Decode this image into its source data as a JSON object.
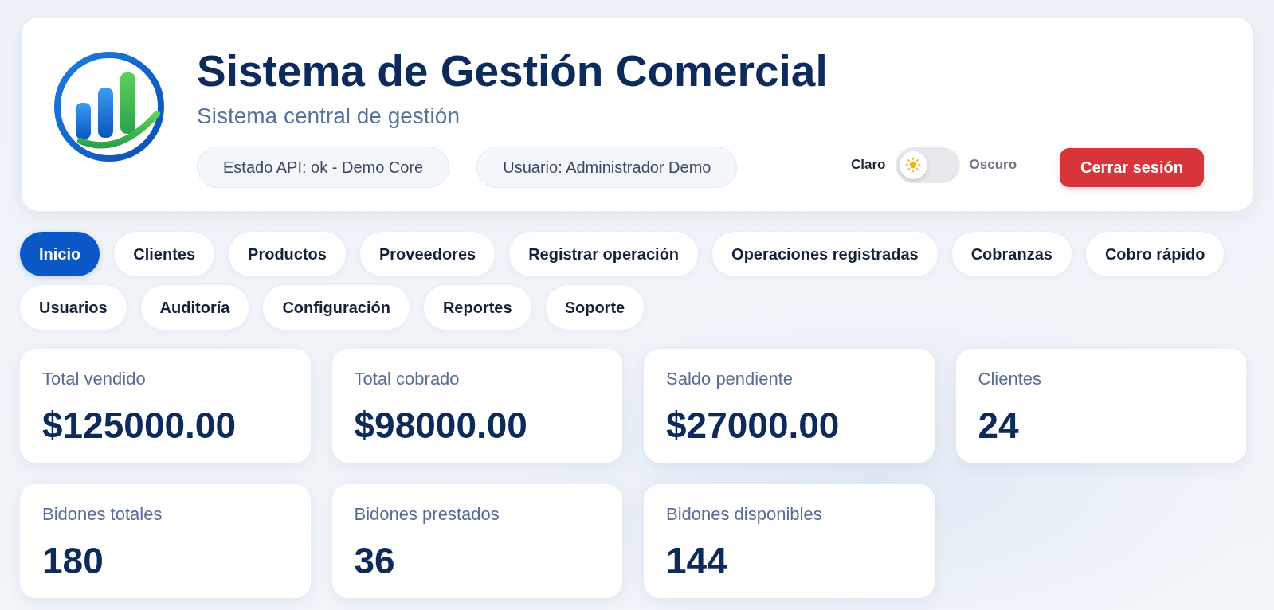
{
  "header": {
    "title": "Sistema de Gestión Comercial",
    "subtitle": "Sistema central de gestión",
    "status_pills": [
      "Estado API: ok - Demo Core",
      "Usuario: Administrador Demo"
    ],
    "theme_toggle": {
      "light_label": "Claro",
      "dark_label": "Oscuro",
      "dark": false
    },
    "logout_button": "Cerrar sesión"
  },
  "nav_tabs": [
    {
      "label": "Inicio",
      "selected": true
    },
    {
      "label": "Clientes",
      "selected": false
    },
    {
      "label": "Productos",
      "selected": false
    },
    {
      "label": "Proveedores",
      "selected": false
    },
    {
      "label": "Registrar operación",
      "selected": false
    },
    {
      "label": "Operaciones registradas",
      "selected": false
    },
    {
      "label": "Cobranzas",
      "selected": false
    },
    {
      "label": "Cobro rápido",
      "selected": false
    },
    {
      "label": "Usuarios",
      "selected": false
    },
    {
      "label": "Auditoría",
      "selected": false
    },
    {
      "label": "Configuración",
      "selected": false
    },
    {
      "label": "Reportes",
      "selected": false
    },
    {
      "label": "Soporte",
      "selected": false
    }
  ],
  "stat_cards": [
    {
      "label": "Total vendido",
      "value": "$125000.00"
    },
    {
      "label": "Total cobrado",
      "value": "$98000.00"
    },
    {
      "label": "Saldo pendiente",
      "value": "$27000.00"
    },
    {
      "label": "Clientes",
      "value": "24"
    },
    {
      "label": "Bidones totales",
      "value": "180"
    },
    {
      "label": "Bidones prestados",
      "value": "36"
    },
    {
      "label": "Bidones disponibles",
      "value": "144"
    }
  ]
}
